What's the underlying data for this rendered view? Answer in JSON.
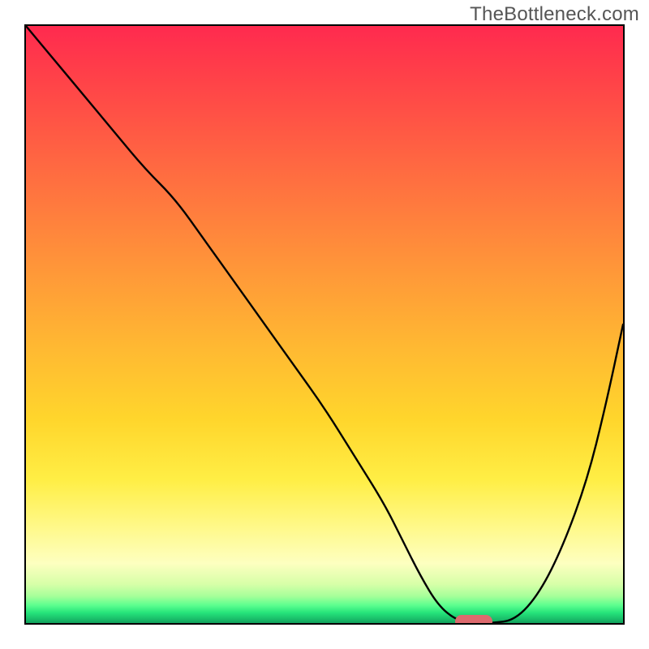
{
  "watermark": "TheBottleneck.com",
  "chart_data": {
    "type": "line",
    "title": "",
    "xlabel": "",
    "ylabel": "",
    "xlim": [
      0,
      100
    ],
    "ylim": [
      0,
      100
    ],
    "grid": false,
    "legend": false,
    "series": [
      {
        "name": "bottleneck-curve",
        "x": [
          0,
          5,
          10,
          15,
          20,
          25,
          30,
          35,
          40,
          45,
          50,
          55,
          60,
          63,
          66,
          69,
          72,
          75,
          78,
          82,
          86,
          90,
          94,
          97,
          100
        ],
        "y": [
          100,
          94,
          88,
          82,
          76,
          71,
          64,
          57,
          50,
          43,
          36,
          28,
          20,
          14,
          8,
          3,
          0.5,
          0,
          0,
          0.5,
          5,
          13,
          24,
          36,
          50
        ]
      }
    ],
    "marker": {
      "name": "optimal-point",
      "x": 75,
      "y": 0,
      "color": "#dd6a6e"
    },
    "background_gradient": {
      "top": "#ff2a4f",
      "middle": "#ffd62c",
      "bottom": "#12a25d"
    }
  }
}
